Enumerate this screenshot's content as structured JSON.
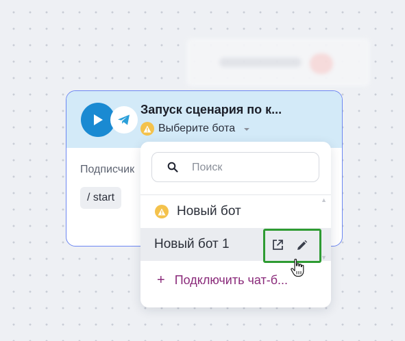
{
  "node": {
    "title": "Запуск сценария по к...",
    "bot_select_label": "Выберите бота",
    "subscription_label": "Подписчик",
    "command_chip": "/ start"
  },
  "dropdown": {
    "search_placeholder": "Поиск",
    "options": [
      {
        "label": "Новый бот",
        "warning": true
      },
      {
        "label": "Новый бот 1",
        "selected": true
      }
    ],
    "connect_label": "Подключить чат-б..."
  },
  "icons": {
    "play": "play-icon",
    "telegram": "telegram-icon",
    "warning": "warning-icon",
    "search": "search-icon",
    "open_external": "open-external-icon",
    "edit": "pencil-icon",
    "cursor": "hand-pointer-cursor"
  },
  "colors": {
    "accent_blue": "#1a8ad2",
    "node_border": "#6b86f2",
    "header_bg": "#d3eaf8",
    "warning": "#f4c24c",
    "connect_purple": "#8a2a7a",
    "highlight_green": "#2e9b32"
  }
}
